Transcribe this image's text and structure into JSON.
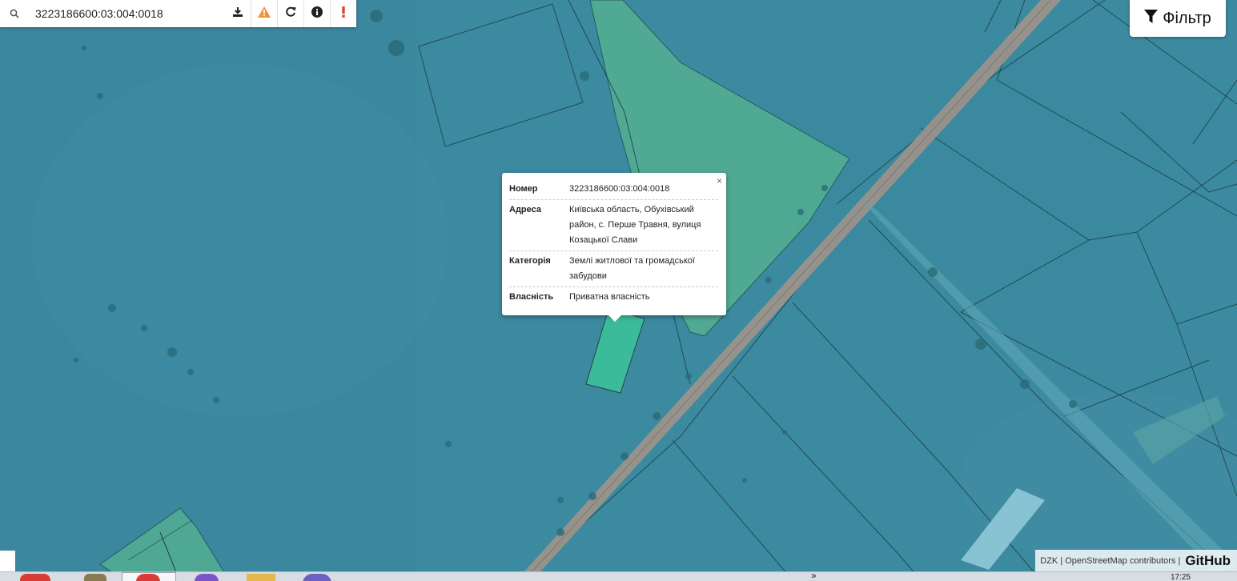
{
  "search": {
    "value": "3223186600:03:004:0018"
  },
  "toolbar": {
    "download_icon": "download-icon",
    "warning_icon": "warning-icon",
    "refresh_icon": "refresh-icon",
    "info_icon": "info-icon",
    "alert_icon": "exclamation-icon"
  },
  "filter": {
    "label": "Фільтр"
  },
  "popup": {
    "close": "×",
    "rows": [
      {
        "key": "Номер",
        "value": "3223186600:03:004:0018"
      },
      {
        "key": "Адреса",
        "value": "Київська область, Обухівський район, с. Перше Травня, вулиця Козацької Слави"
      },
      {
        "key": "Категорія",
        "value": "Землі житлової та громадської забудови"
      },
      {
        "key": "Власність",
        "value": "Приватна власність"
      }
    ]
  },
  "attribution": {
    "text": "DZK | OpenStreetMap contributors |",
    "github": "GitHub"
  },
  "taskbar": {
    "clock": "17:25",
    "chevron": "»"
  },
  "colors": {
    "map_base": "#3c8aa0",
    "parcel_green": "#5fbf8f",
    "selected_parcel": "#3ec39a",
    "road": "#9a8f86"
  }
}
